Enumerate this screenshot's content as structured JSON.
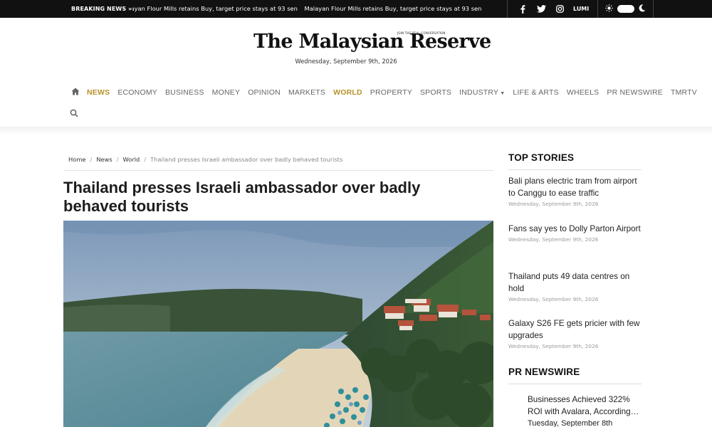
{
  "topbar": {
    "breaking_label": "BREAKING NEWS »",
    "ticker": [
      "Malayan Flour Mills retains Buy, target price stays at 93 sen",
      "Malayan Flour Mills retains Buy, target price stays at 93 sen"
    ],
    "social": {
      "facebook": "f",
      "twitter": "twitter-icon",
      "instagram": "instagram-icon",
      "lumi_label": "LUMI"
    },
    "theme_icons": [
      "sun-icon",
      "toggle",
      "moon-icon"
    ]
  },
  "masthead": {
    "logo_text": "The Malaysian Reserve",
    "tagline": "JOIN THE REAL CONVERSATION",
    "date": "Wednesday, September 9th, 2026"
  },
  "nav": {
    "items": [
      {
        "label": "NEWS",
        "active": true
      },
      {
        "label": "ECONOMY",
        "active": false
      },
      {
        "label": "BUSINESS",
        "active": false
      },
      {
        "label": "MONEY",
        "active": false
      },
      {
        "label": "OPINION",
        "active": false
      },
      {
        "label": "MARKETS",
        "active": false
      },
      {
        "label": "WORLD",
        "active": true
      },
      {
        "label": "PROPERTY",
        "active": false
      },
      {
        "label": "SPORTS",
        "active": false
      },
      {
        "label": "INDUSTRY",
        "active": false,
        "dropdown": true
      },
      {
        "label": "LIFE & ARTS",
        "active": false
      },
      {
        "label": "WHEELS",
        "active": false
      },
      {
        "label": "PR NEWSWIRE",
        "active": false
      },
      {
        "label": "TMRTV",
        "active": false
      }
    ],
    "accent_color": "#b8922c"
  },
  "breadcrumb": {
    "items": [
      "Home",
      "News",
      "World"
    ],
    "current": "Thailand presses Israeli ambassador over badly behaved tourists"
  },
  "article": {
    "headline": "Thailand presses Israeli ambassador over badly behaved tourists"
  },
  "sidebar": {
    "top_stories_title": "TOP STORIES",
    "stories": [
      {
        "title": "Bali plans electric tram from airport to Canggu to ease traffic",
        "date": "Wednesday, September 9th, 2026"
      },
      {
        "title": "Fans say yes to Dolly Parton Airport",
        "date": "Wednesday, September 9th, 2026"
      },
      {
        "title": "Thailand puts 49 data centres on hold",
        "date": "Wednesday, September 9th, 2026"
      },
      {
        "title": "Galaxy S26 FE gets pricier with few upgrades",
        "date": "Wednesday, September 9th, 2026"
      }
    ],
    "pr_title": "PR NEWSWIRE",
    "pr_items": [
      {
        "title": "Businesses Achieved 322% ROI with Avalara, According…",
        "date": "Tuesday, September 8th"
      }
    ]
  }
}
